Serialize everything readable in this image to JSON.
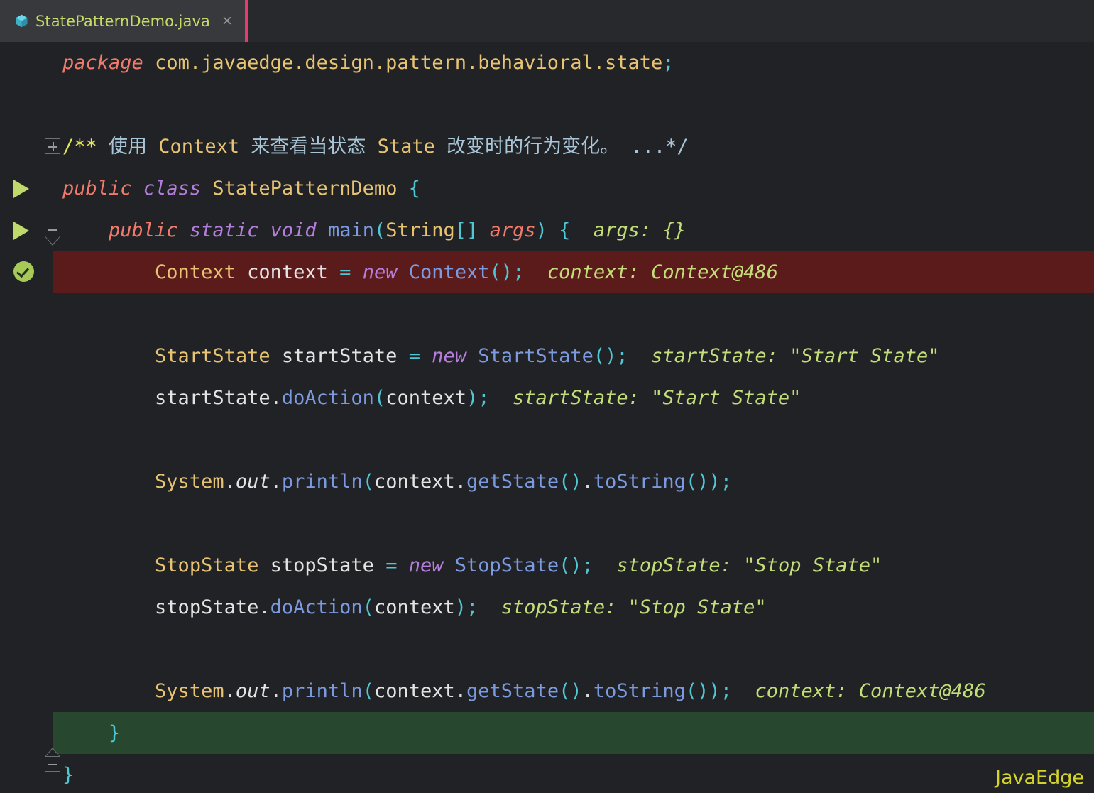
{
  "window": {
    "theme_bg": "#212225",
    "tabbar_bg": "#27292c"
  },
  "tabbar": {
    "tabs": [
      {
        "label": "StatePatternDemo.java",
        "icon": "java-class-icon",
        "close_label": "×",
        "active": true,
        "active_border_color": "#e83a6e",
        "label_color": "#c7da67"
      }
    ]
  },
  "editor": {
    "highlight_exec_color": "#5c1b1b",
    "highlight_ok_color": "#28472f",
    "gutter": {
      "run_marker_color": "#bfd96b",
      "check_marker_color": "#a7c957",
      "fold_marker_color": "#6d7074"
    },
    "lines": [
      {
        "n": 1,
        "tokens": [
          {
            "t": "package",
            "c": "k-kw"
          },
          {
            "t": " ",
            "c": "k-ident"
          },
          {
            "t": "com.javaedge.design.pattern.behavioral.state",
            "c": "k-type"
          },
          {
            "t": ";",
            "c": "k-punct"
          }
        ]
      },
      {
        "n": 2,
        "tokens": []
      },
      {
        "n": 3,
        "tokens": [
          {
            "t": "/**",
            "c": "k-docmark"
          },
          {
            "t": " 使用 ",
            "c": "k-doc"
          },
          {
            "t": "Context",
            "c": "k-doctag"
          },
          {
            "t": " 来查看当状态 ",
            "c": "k-doc"
          },
          {
            "t": "State",
            "c": "k-doctag"
          },
          {
            "t": " 改变时的行为变化。 ...*/",
            "c": "k-doc"
          }
        ]
      },
      {
        "n": 4,
        "tokens": [
          {
            "t": "public",
            "c": "k-kw"
          },
          {
            "t": " ",
            "c": "k-ident"
          },
          {
            "t": "class",
            "c": "k-kw2"
          },
          {
            "t": " ",
            "c": "k-ident"
          },
          {
            "t": "StatePatternDemo",
            "c": "k-type"
          },
          {
            "t": " ",
            "c": "k-ident"
          },
          {
            "t": "{",
            "c": "k-punct"
          }
        ]
      },
      {
        "n": 5,
        "tokens": [
          {
            "t": "    ",
            "c": "k-ident"
          },
          {
            "t": "public",
            "c": "k-kw"
          },
          {
            "t": " ",
            "c": "k-ident"
          },
          {
            "t": "static",
            "c": "k-kw2"
          },
          {
            "t": " ",
            "c": "k-ident"
          },
          {
            "t": "void",
            "c": "k-kw2"
          },
          {
            "t": " ",
            "c": "k-ident"
          },
          {
            "t": "main",
            "c": "k-method"
          },
          {
            "t": "(",
            "c": "k-punct"
          },
          {
            "t": "String",
            "c": "k-type"
          },
          {
            "t": "[]",
            "c": "k-punct"
          },
          {
            "t": " ",
            "c": "k-ident"
          },
          {
            "t": "args",
            "c": "k-kw"
          },
          {
            "t": ")",
            "c": "k-punct"
          },
          {
            "t": " ",
            "c": "k-ident"
          },
          {
            "t": "{",
            "c": "k-punct"
          },
          {
            "t": "  args: {}",
            "c": "k-hint"
          }
        ]
      },
      {
        "n": 6,
        "highlight": "exec",
        "tokens": [
          {
            "t": "        ",
            "c": "k-ident"
          },
          {
            "t": "Context",
            "c": "k-type"
          },
          {
            "t": " ",
            "c": "k-ident"
          },
          {
            "t": "context",
            "c": "k-ident"
          },
          {
            "t": " ",
            "c": "k-ident"
          },
          {
            "t": "=",
            "c": "k-punct"
          },
          {
            "t": " ",
            "c": "k-ident"
          },
          {
            "t": "new",
            "c": "k-kw2"
          },
          {
            "t": " ",
            "c": "k-ident"
          },
          {
            "t": "Context",
            "c": "k-method"
          },
          {
            "t": "()",
            "c": "k-punct"
          },
          {
            "t": ";",
            "c": "k-punct"
          },
          {
            "t": "  context: Context@486",
            "c": "k-hint"
          }
        ]
      },
      {
        "n": 7,
        "tokens": []
      },
      {
        "n": 8,
        "tokens": [
          {
            "t": "        ",
            "c": "k-ident"
          },
          {
            "t": "StartState",
            "c": "k-type"
          },
          {
            "t": " ",
            "c": "k-ident"
          },
          {
            "t": "startState",
            "c": "k-ident"
          },
          {
            "t": " ",
            "c": "k-ident"
          },
          {
            "t": "=",
            "c": "k-punct"
          },
          {
            "t": " ",
            "c": "k-ident"
          },
          {
            "t": "new",
            "c": "k-kw2"
          },
          {
            "t": " ",
            "c": "k-ident"
          },
          {
            "t": "StartState",
            "c": "k-method"
          },
          {
            "t": "()",
            "c": "k-punct"
          },
          {
            "t": ";",
            "c": "k-punct"
          },
          {
            "t": "  startState: \"Start State\"",
            "c": "k-hint"
          }
        ]
      },
      {
        "n": 9,
        "tokens": [
          {
            "t": "        ",
            "c": "k-ident"
          },
          {
            "t": "startState",
            "c": "k-ident"
          },
          {
            "t": ".",
            "c": "k-dot"
          },
          {
            "t": "doAction",
            "c": "k-method"
          },
          {
            "t": "(",
            "c": "k-punct"
          },
          {
            "t": "context",
            "c": "k-ident"
          },
          {
            "t": ")",
            "c": "k-punct"
          },
          {
            "t": ";",
            "c": "k-punct"
          },
          {
            "t": "  startState: \"Start State\"",
            "c": "k-hint"
          }
        ]
      },
      {
        "n": 10,
        "tokens": []
      },
      {
        "n": 11,
        "tokens": [
          {
            "t": "        ",
            "c": "k-ident"
          },
          {
            "t": "System",
            "c": "k-type"
          },
          {
            "t": ".",
            "c": "k-dot"
          },
          {
            "t": "out",
            "c": "k-field"
          },
          {
            "t": ".",
            "c": "k-dot"
          },
          {
            "t": "println",
            "c": "k-method"
          },
          {
            "t": "(",
            "c": "k-punct"
          },
          {
            "t": "context",
            "c": "k-ident"
          },
          {
            "t": ".",
            "c": "k-dot"
          },
          {
            "t": "getState",
            "c": "k-method"
          },
          {
            "t": "()",
            "c": "k-punct"
          },
          {
            "t": ".",
            "c": "k-dot"
          },
          {
            "t": "toString",
            "c": "k-method"
          },
          {
            "t": "())",
            "c": "k-punct"
          },
          {
            "t": ";",
            "c": "k-punct"
          }
        ]
      },
      {
        "n": 12,
        "tokens": []
      },
      {
        "n": 13,
        "tokens": [
          {
            "t": "        ",
            "c": "k-ident"
          },
          {
            "t": "StopState",
            "c": "k-type"
          },
          {
            "t": " ",
            "c": "k-ident"
          },
          {
            "t": "stopState",
            "c": "k-ident"
          },
          {
            "t": " ",
            "c": "k-ident"
          },
          {
            "t": "=",
            "c": "k-punct"
          },
          {
            "t": " ",
            "c": "k-ident"
          },
          {
            "t": "new",
            "c": "k-kw2"
          },
          {
            "t": " ",
            "c": "k-ident"
          },
          {
            "t": "StopState",
            "c": "k-method"
          },
          {
            "t": "()",
            "c": "k-punct"
          },
          {
            "t": ";",
            "c": "k-punct"
          },
          {
            "t": "  stopState: \"Stop State\"",
            "c": "k-hint"
          }
        ]
      },
      {
        "n": 14,
        "tokens": [
          {
            "t": "        ",
            "c": "k-ident"
          },
          {
            "t": "stopState",
            "c": "k-ident"
          },
          {
            "t": ".",
            "c": "k-dot"
          },
          {
            "t": "doAction",
            "c": "k-method"
          },
          {
            "t": "(",
            "c": "k-punct"
          },
          {
            "t": "context",
            "c": "k-ident"
          },
          {
            "t": ")",
            "c": "k-punct"
          },
          {
            "t": ";",
            "c": "k-punct"
          },
          {
            "t": "  stopState: \"Stop State\"",
            "c": "k-hint"
          }
        ]
      },
      {
        "n": 15,
        "tokens": []
      },
      {
        "n": 16,
        "tokens": [
          {
            "t": "        ",
            "c": "k-ident"
          },
          {
            "t": "System",
            "c": "k-type"
          },
          {
            "t": ".",
            "c": "k-dot"
          },
          {
            "t": "out",
            "c": "k-field"
          },
          {
            "t": ".",
            "c": "k-dot"
          },
          {
            "t": "println",
            "c": "k-method"
          },
          {
            "t": "(",
            "c": "k-punct"
          },
          {
            "t": "context",
            "c": "k-ident"
          },
          {
            "t": ".",
            "c": "k-dot"
          },
          {
            "t": "getState",
            "c": "k-method"
          },
          {
            "t": "()",
            "c": "k-punct"
          },
          {
            "t": ".",
            "c": "k-dot"
          },
          {
            "t": "toString",
            "c": "k-method"
          },
          {
            "t": "())",
            "c": "k-punct"
          },
          {
            "t": ";",
            "c": "k-punct"
          },
          {
            "t": "  context: Context@486",
            "c": "k-hint"
          }
        ]
      },
      {
        "n": 17,
        "highlight": "ok",
        "tokens": [
          {
            "t": "    ",
            "c": "k-ident"
          },
          {
            "t": "}",
            "c": "k-punct"
          }
        ]
      },
      {
        "n": 18,
        "tokens": [
          {
            "t": "}",
            "c": "k-punct"
          }
        ]
      }
    ]
  },
  "watermark": {
    "text": "JavaEdge",
    "color": "#d4d42a"
  }
}
